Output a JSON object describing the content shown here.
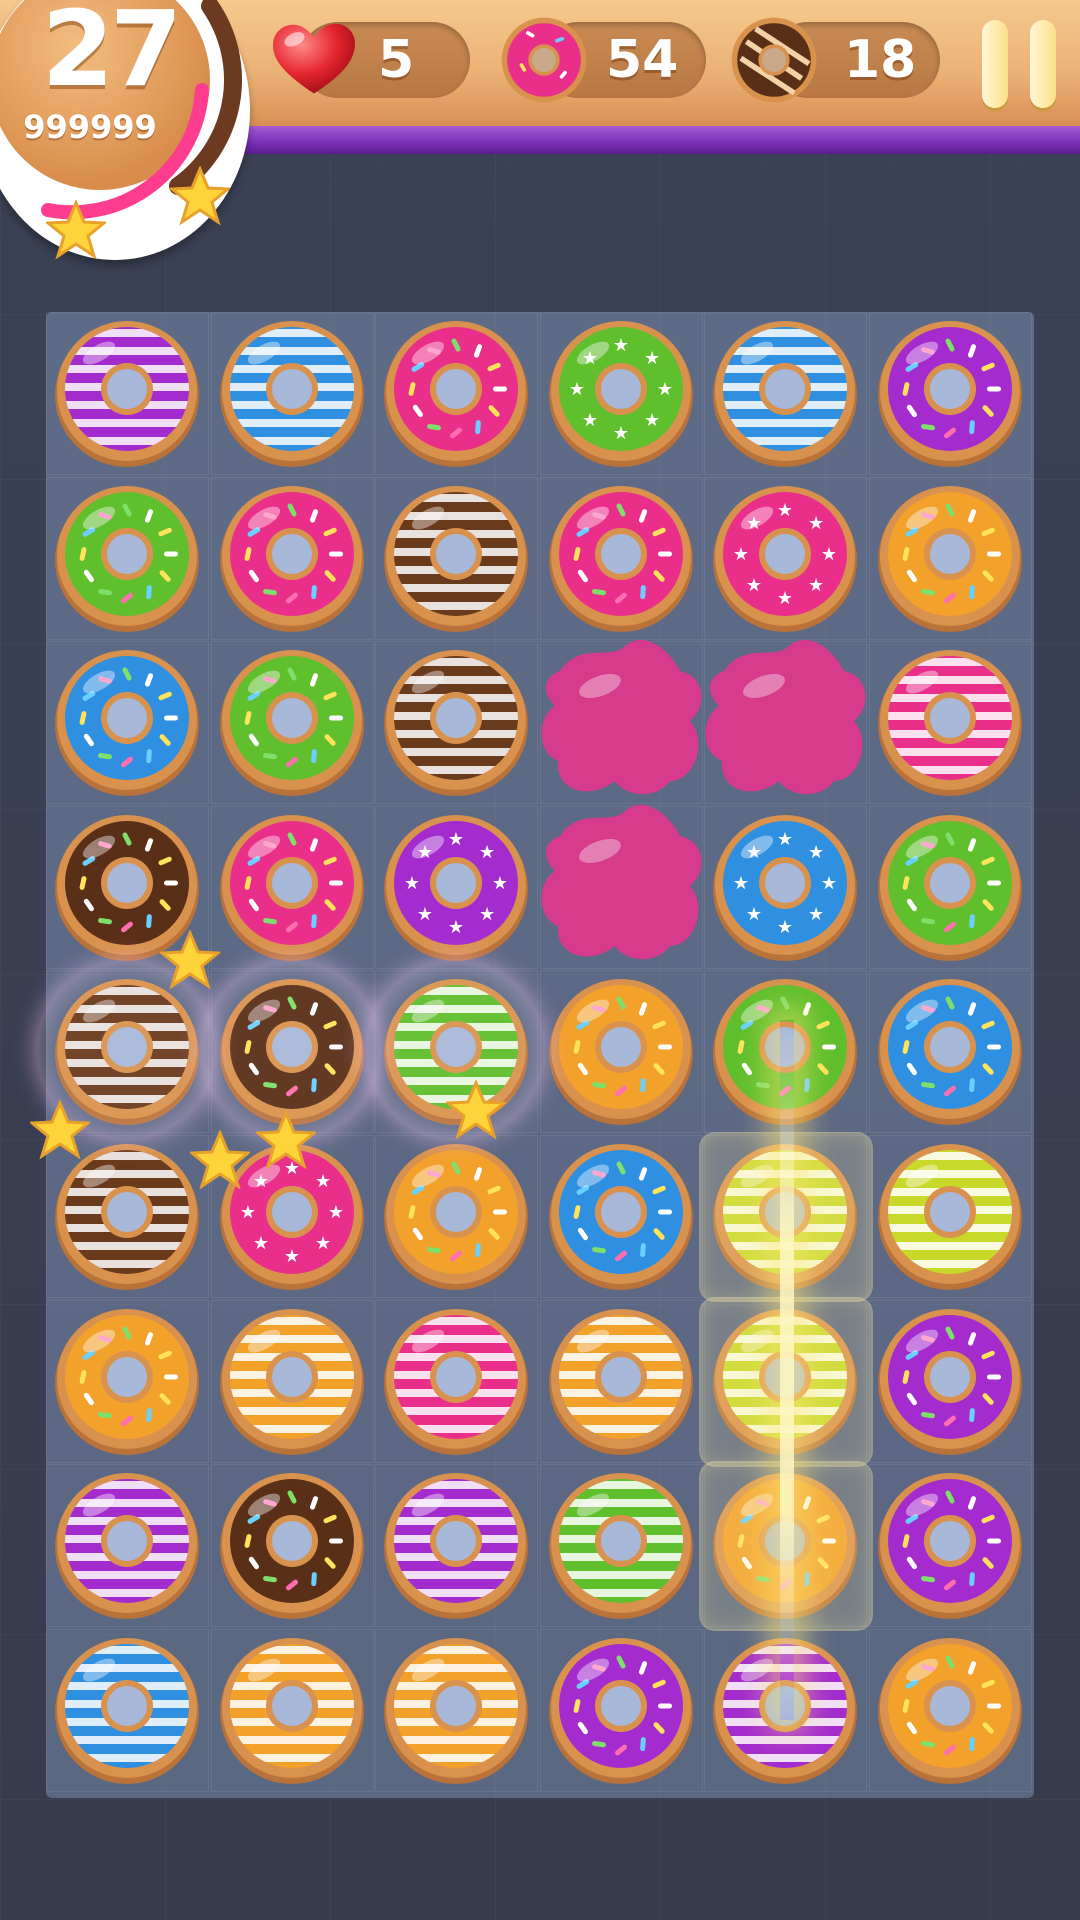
{
  "hud": {
    "level": "27",
    "score": "999999",
    "lives": "5",
    "pink_donut_count": "54",
    "brown_donut_count": "18"
  },
  "icons": {
    "lives": "heart-icon",
    "pink_goal": "pink-donut-icon",
    "brown_goal": "chocolate-donut-icon",
    "pause": "pause-icon",
    "level_stars": "star-icon"
  },
  "board": {
    "columns": 6,
    "rows": 9,
    "grid": [
      [
        "purple-striped",
        "blue-striped",
        "pink-sprinkles",
        "green-stars",
        "blue-striped",
        "purple-sprinkles"
      ],
      [
        "green-sprinkles",
        "pink-sprinkles",
        "brown-striped",
        "pink-sprinkles",
        "pink-stars",
        "orange-sprinkles"
      ],
      [
        "blue-sprinkles",
        "green-sprinkles",
        "brown-striped",
        "jelly",
        "jelly",
        "pink-striped"
      ],
      [
        "chocolate-sprinkles",
        "pink-sprinkles",
        "purple-stars",
        "jelly",
        "blue-stars",
        "green-sprinkles"
      ],
      [
        "brown-striped",
        "chocolate-sprinkles",
        "green-striped",
        "orange-sprinkles",
        "green-sprinkles",
        "blue-sprinkles"
      ],
      [
        "brown-striped",
        "pink-stars",
        "orange-sprinkles",
        "blue-sprinkles",
        "yellow-striped",
        "yellow-striped"
      ],
      [
        "orange-sprinkles",
        "orange-striped",
        "pink-striped",
        "orange-striped",
        "yellow-striped",
        "purple-sprinkles"
      ],
      [
        "purple-striped",
        "chocolate-sprinkles",
        "purple-striped",
        "green-striped",
        "orange-sprinkles",
        "purple-sprinkles"
      ],
      [
        "blue-striped",
        "orange-striped",
        "orange-striped",
        "purple-sprinkles",
        "purple-striped",
        "orange-sprinkles"
      ]
    ],
    "matched_bubbles": [
      [
        4,
        0
      ],
      [
        4,
        1
      ],
      [
        4,
        2
      ]
    ],
    "highlighted_cells": [
      [
        5,
        4
      ],
      [
        6,
        4
      ],
      [
        7,
        4
      ]
    ]
  },
  "colors": {
    "purple": "#a42ccf",
    "blue": "#2f8fe0",
    "pink": "#ea2f8a",
    "green": "#5fbf2c",
    "brown": "#6a3a1c",
    "orange": "#f2a12b",
    "yellow": "#c8d92a",
    "chocolate": "#5a2f18",
    "dough": "#d9924e",
    "jelly": "#d63b8c"
  }
}
